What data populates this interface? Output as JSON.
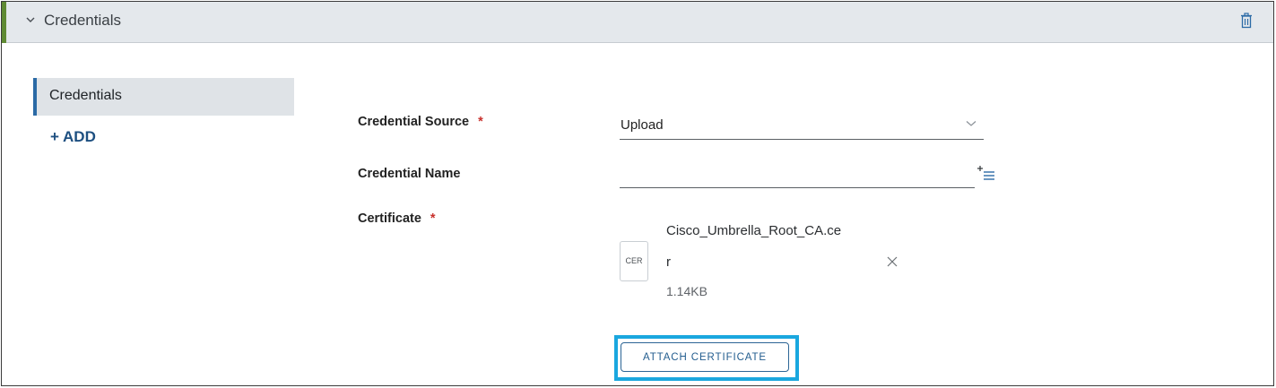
{
  "section": {
    "title": "Credentials",
    "accent_color": "#5f8a33",
    "collapse_icon": "chevron-down-icon",
    "delete_icon": "trash-icon"
  },
  "nav": {
    "items": [
      {
        "label": "Credentials",
        "selected": true
      }
    ],
    "add_label": "+ ADD"
  },
  "form": {
    "credential_source": {
      "label": "Credential Source",
      "required_mark": "*",
      "value": "Upload"
    },
    "credential_name": {
      "label": "Credential Name",
      "value": "",
      "action_icon": "add-list-icon"
    },
    "certificate": {
      "label": "Certificate",
      "required_mark": "*",
      "file": {
        "type_badge": "CER",
        "name_line1": "Cisco_Umbrella_Root_CA.ce",
        "name_line2": "r",
        "size": "1.14KB"
      }
    },
    "attach_button_label": "ATTACH CERTIFICATE"
  },
  "colors": {
    "highlight": "#1aa7df",
    "required": "#c8302c",
    "link": "#1d4f80"
  }
}
